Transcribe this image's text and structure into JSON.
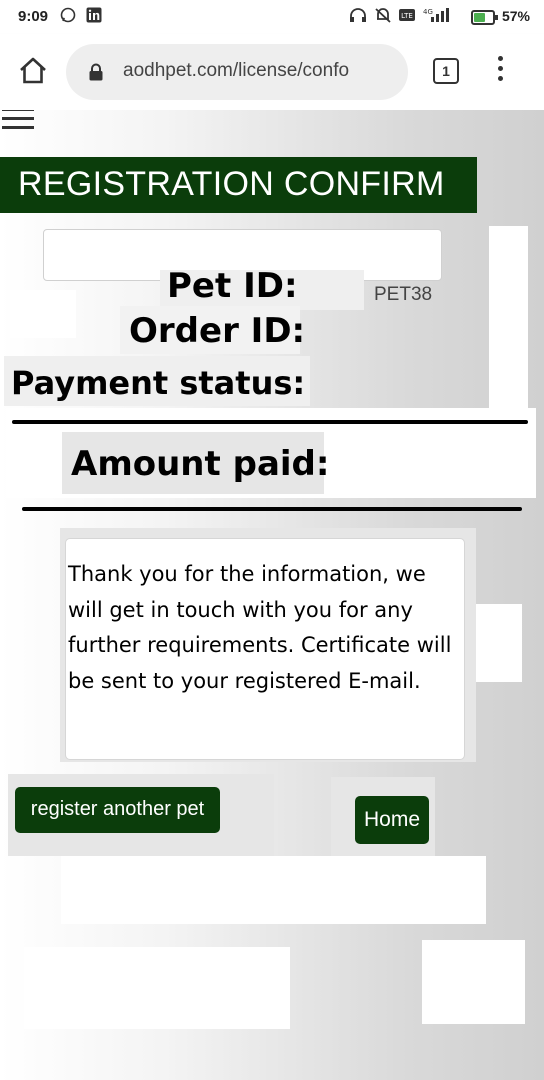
{
  "status_bar": {
    "time": "9:09",
    "battery_percent": "57%",
    "battery_level": 0.57,
    "icons": [
      "whatsapp-icon",
      "linkedin-icon",
      "headset-icon",
      "mute-icon",
      "volte-icon",
      "signal-4g-icon",
      "battery-charging-icon"
    ]
  },
  "browser": {
    "url": "aodhpet.com/license/confo",
    "tab_count": "1"
  },
  "page": {
    "title": "REGISTRATION CONFIRM",
    "pet_id_label": "Pet ID:",
    "pet_id_value": "PET38",
    "order_id_label": "Order ID:",
    "payment_status_label": "Payment status:",
    "amount_paid_label": "Amount paid:",
    "message": "Thank you for the information, we will get in touch with you for any further requirements. Certificate will be sent to your registered E-mail.",
    "register_another_button": "register another pet",
    "home_button": "Home"
  },
  "colors": {
    "accent": "#0b3d0b",
    "button_text": "#ffffff"
  }
}
